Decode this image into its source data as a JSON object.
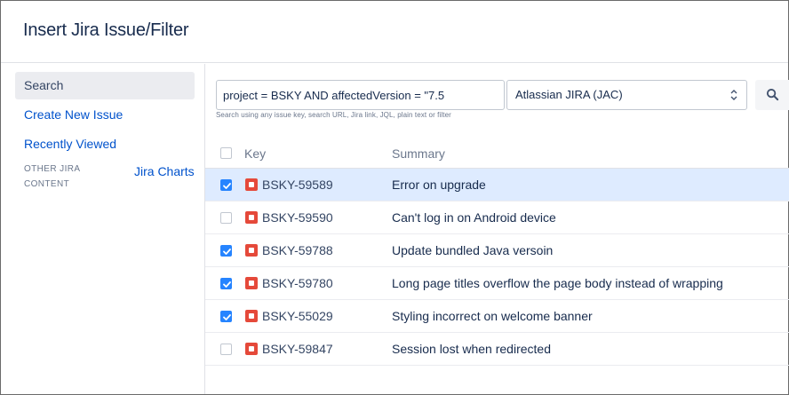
{
  "dialog": {
    "title": "Insert Jira Issue/Filter"
  },
  "sidebar": {
    "items": [
      {
        "label": "Search",
        "active": true
      },
      {
        "label": "Create New Issue",
        "active": false
      },
      {
        "label": "Recently Viewed",
        "active": false
      }
    ],
    "other_content_label": "OTHER JIRA CONTENT",
    "jira_charts": "Jira Charts"
  },
  "search": {
    "query": "project = BSKY AND affectedVersion = \"7.5",
    "server": "Atlassian JIRA (JAC)",
    "helper": "Search using any issue key, search URL, Jira link, JQL, plain text or filter",
    "button_icon": "search-icon"
  },
  "table": {
    "columns": {
      "key": "Key",
      "summary": "Summary"
    },
    "rows": [
      {
        "key": "BSKY-59589",
        "summary": "Error on upgrade",
        "checked": true,
        "highlighted": true
      },
      {
        "key": "BSKY-59590",
        "summary": "Can't log in on Android device",
        "checked": false,
        "highlighted": false
      },
      {
        "key": "BSKY-59788",
        "summary": "Update bundled Java versoin",
        "checked": true,
        "highlighted": false
      },
      {
        "key": "BSKY-59780",
        "summary": "Long page titles overflow the page body instead of wrapping",
        "checked": true,
        "highlighted": false
      },
      {
        "key": "BSKY-55029",
        "summary": "Styling incorrect on welcome banner",
        "checked": true,
        "highlighted": false
      },
      {
        "key": "BSKY-59847",
        "summary": "Session lost when redirected",
        "checked": false,
        "highlighted": false
      }
    ]
  },
  "colors": {
    "accent": "#0052cc",
    "checkbox_checked": "#2684ff",
    "row_highlight": "#deebff",
    "bug_icon": "#e5493a"
  }
}
